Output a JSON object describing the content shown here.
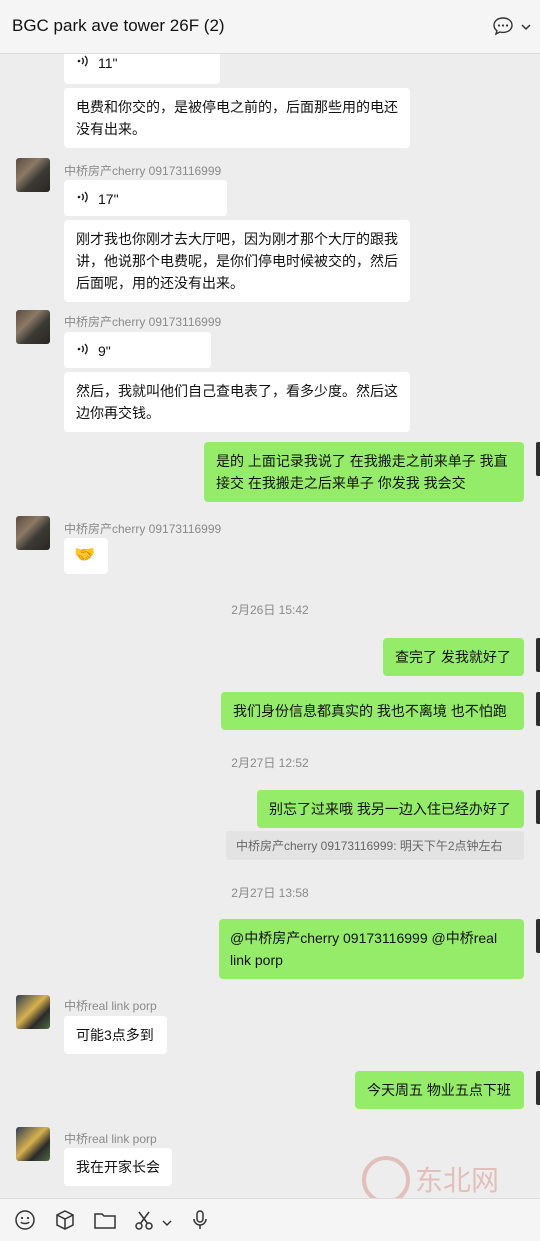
{
  "header": {
    "title": "BGC park ave tower 26F (2)"
  },
  "messages": {
    "m0": {
      "duration": "11\""
    },
    "m1": {
      "text": "电费和你交的，是被停电之前的，后面那些用的电还没有出来。"
    },
    "g1": {
      "sender": "中桥房产cherry 09173116999"
    },
    "m2": {
      "duration": "17\""
    },
    "m3": {
      "text": "刚才我也你刚才去大厅吧，因为刚才那个大厅的跟我讲，他说那个电费呢，是你们停电时候被交的，然后后面呢，用的还没有出来。"
    },
    "g2": {
      "sender": "中桥房产cherry 09173116999"
    },
    "m4": {
      "duration": "9\""
    },
    "m5": {
      "text": "然后，我就叫他们自己查电表了，看多少度。然后这边你再交钱。"
    },
    "m6": {
      "text": "是的 上面记录我说了  在我搬走之前来单子 我直接交  在我搬走之后来单子 你发我 我会交"
    },
    "g3": {
      "sender": "中桥房产cherry 09173116999"
    },
    "m7": {
      "emoji": "🤝"
    },
    "t1": "2月26日 15:42",
    "m8": {
      "text": "查完了 发我就好了"
    },
    "m9": {
      "text": "我们身份信息都真实的  我也不离境 也不怕跑"
    },
    "t2": "2月27日 12:52",
    "m10": {
      "text": "别忘了过来哦 我另一边入住已经办好了"
    },
    "q1": {
      "text": "中桥房产cherry 09173116999: 明天下午2点钟左右"
    },
    "t3": "2月27日 13:58",
    "m11": {
      "text": "@中桥房产cherry 09173116999  @中桥real link porp"
    },
    "g4": {
      "sender": "中桥real link porp"
    },
    "m12": {
      "text": "可能3点多到"
    },
    "m13": {
      "text": "今天周五 物业五点下班"
    },
    "g5": {
      "sender": "中桥real link porp"
    },
    "m14": {
      "text": "我在开家长会"
    }
  },
  "watermark": {
    "text": "东北网"
  },
  "colors": {
    "mine_bubble": "#95ec69",
    "other_bubble": "#ffffff",
    "background": "#ededed"
  }
}
